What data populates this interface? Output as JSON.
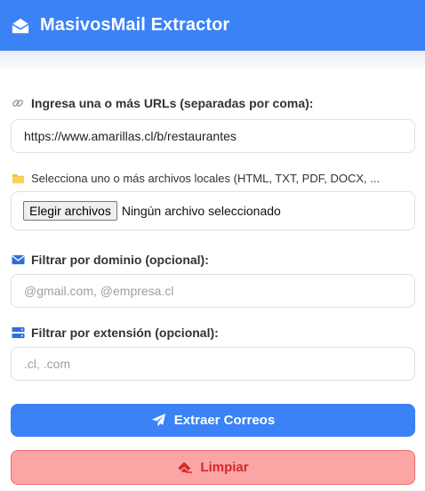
{
  "header": {
    "title": "MasivosMail Extractor",
    "logo_icon": "envelope-open-icon",
    "color": "#3b82f6"
  },
  "urls": {
    "label": "Ingresa una o más URLs (separadas por coma):",
    "icon": "link-icon",
    "value": "https://www.amarillas.cl/b/restaurantes"
  },
  "files": {
    "label": "Selecciona uno o más archivos locales (HTML, TXT, PDF, DOCX, ...",
    "icon": "folder-icon",
    "button_label": "Elegir archivos",
    "status": "Ningún archivo seleccionado"
  },
  "domain": {
    "label": "Filtrar por dominio (opcional):",
    "icon": "envelope-icon",
    "placeholder": "@gmail.com, @empresa.cl"
  },
  "extension": {
    "label": "Filtrar por extensión (opcional):",
    "icon": "server-icon",
    "placeholder": ".cl, .com"
  },
  "actions": {
    "extract_label": "Extraer Correos",
    "extract_icon": "paper-plane-icon",
    "clear_label": "Limpiar",
    "clear_icon": "eraser-icon",
    "danger_color": "#d42a2a"
  }
}
